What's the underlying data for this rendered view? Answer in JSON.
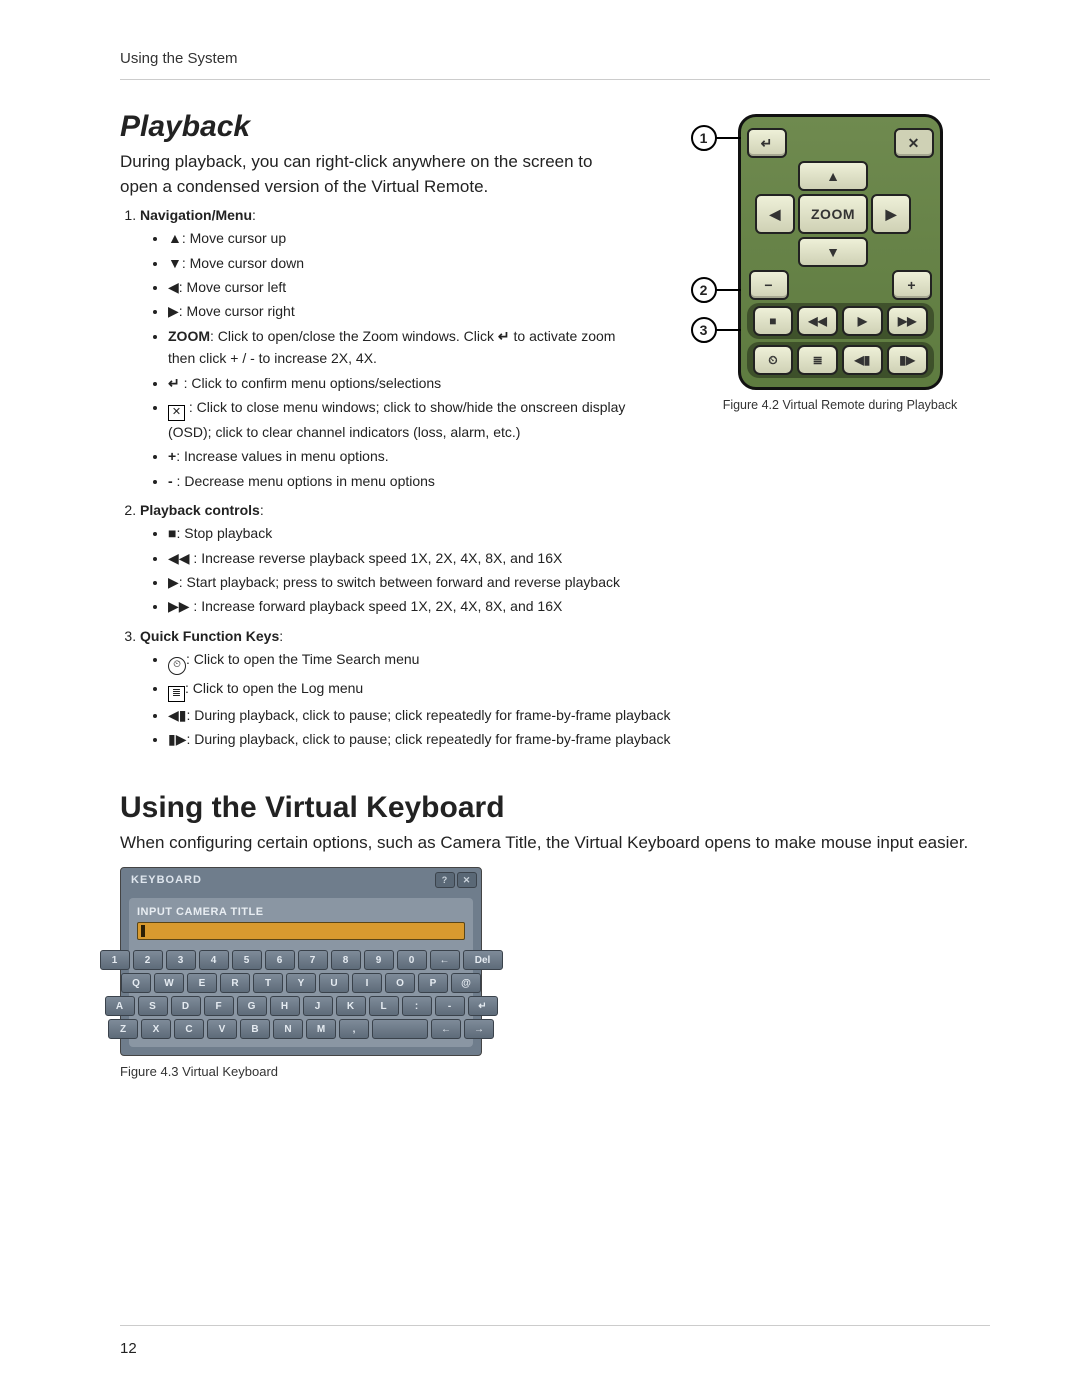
{
  "header": {
    "section": "Using the System"
  },
  "playback": {
    "title": "Playback",
    "intro": "During playback, you can right-click anywhere on the screen to open a condensed version of the Virtual Remote.",
    "remote_caption": "Figure 4.2 Virtual Remote during Playback",
    "remote": {
      "zoom": "ZOOM",
      "callouts": [
        "1",
        "2",
        "3"
      ]
    },
    "sections": [
      {
        "title": "Navigation/Menu",
        "items": [
          {
            "icon": "▲",
            "text": ": Move cursor up"
          },
          {
            "icon": "▼",
            "text": ": Move cursor down"
          },
          {
            "icon": "◀",
            "text": ": Move cursor left"
          },
          {
            "icon": "▶",
            "text": ": Move cursor right"
          },
          {
            "prefix": "ZOOM",
            "text": ": Click to open/close the Zoom windows. Click ",
            "icon2": "↵",
            "text2": " to activate zoom then click + / - to increase 2X, 4X."
          },
          {
            "icon": "↵",
            "text": " : Click to confirm menu options/selections"
          },
          {
            "iconbox": "✕",
            "text": " : Click to close menu windows; click to show/hide the onscreen display (OSD); click to clear channel indicators (loss, alarm, etc.)"
          },
          {
            "prefix": "+",
            "text": ": Increase values in menu options."
          },
          {
            "prefix": "-",
            "text": " : Decrease menu options in menu options"
          }
        ]
      },
      {
        "title": "Playback controls",
        "items": [
          {
            "icon": "■",
            "text": ": Stop playback"
          },
          {
            "icon": "◀◀",
            "text": " : Increase reverse playback speed 1X, 2X, 4X, 8X, and 16X"
          },
          {
            "icon": "▶",
            "text": ": Start playback; press to switch between forward and reverse playback"
          },
          {
            "icon": "▶▶",
            "text": " : Increase forward playback speed 1X, 2X, 4X, 8X, and 16X"
          }
        ]
      },
      {
        "title": "Quick Function Keys",
        "items": [
          {
            "circ": "⏲",
            "text": ": Click to open the Time Search menu"
          },
          {
            "iconbox": "≣",
            "text": ": Click to open the Log menu"
          },
          {
            "icon": "◀▮",
            "text": ": During playback, click to pause; click repeatedly for frame-by-frame playback"
          },
          {
            "icon": "▮▶",
            "text": ": During playback, click to pause; click repeatedly for frame-by-frame playback"
          }
        ]
      }
    ]
  },
  "vk": {
    "title": "Using the Virtual Keyboard",
    "intro": "When configuring certain options, such as Camera Title, the Virtual Keyboard opens to make mouse input easier.",
    "caption": "Figure 4.3 Virtual Keyboard",
    "window_title": "KEYBOARD",
    "field_label": "INPUT CAMERA TITLE",
    "rows": [
      [
        "1",
        "2",
        "3",
        "4",
        "5",
        "6",
        "7",
        "8",
        "9",
        "0",
        "←",
        "Del"
      ],
      [
        "Q",
        "W",
        "E",
        "R",
        "T",
        "Y",
        "U",
        "I",
        "O",
        "P",
        "@"
      ],
      [
        "A",
        "S",
        "D",
        "F",
        "G",
        "H",
        "J",
        "K",
        "L",
        ":",
        "-",
        "↵"
      ],
      [
        "Z",
        "X",
        "C",
        "V",
        "B",
        "N",
        "M",
        ",",
        "␣",
        "←",
        "→"
      ]
    ]
  },
  "footer": {
    "page": "12"
  }
}
